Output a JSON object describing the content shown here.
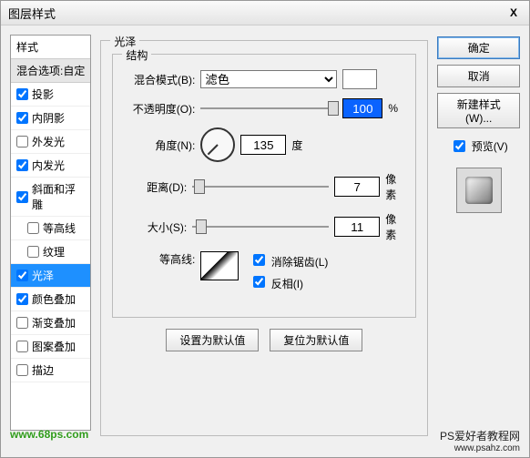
{
  "title": "图层样式",
  "close": "X",
  "sidebar": {
    "header": "样式",
    "sub": "混合选项:自定",
    "items": [
      {
        "label": "投影",
        "checked": true,
        "indent": false,
        "selected": false
      },
      {
        "label": "内阴影",
        "checked": true,
        "indent": false,
        "selected": false
      },
      {
        "label": "外发光",
        "checked": false,
        "indent": false,
        "selected": false
      },
      {
        "label": "内发光",
        "checked": true,
        "indent": false,
        "selected": false
      },
      {
        "label": "斜面和浮雕",
        "checked": true,
        "indent": false,
        "selected": false
      },
      {
        "label": "等高线",
        "checked": false,
        "indent": true,
        "selected": false
      },
      {
        "label": "纹理",
        "checked": false,
        "indent": true,
        "selected": false
      },
      {
        "label": "光泽",
        "checked": true,
        "indent": false,
        "selected": true
      },
      {
        "label": "颜色叠加",
        "checked": true,
        "indent": false,
        "selected": false
      },
      {
        "label": "渐变叠加",
        "checked": false,
        "indent": false,
        "selected": false
      },
      {
        "label": "图案叠加",
        "checked": false,
        "indent": false,
        "selected": false
      },
      {
        "label": "描边",
        "checked": false,
        "indent": false,
        "selected": false
      }
    ]
  },
  "panel": {
    "title": "光泽",
    "group": "结构",
    "blend_label": "混合模式(B):",
    "blend_value": "滤色",
    "opacity_label": "不透明度(O):",
    "opacity_value": "100",
    "percent": "%",
    "angle_label": "角度(N):",
    "angle_value": "135",
    "angle_unit": "度",
    "distance_label": "距离(D):",
    "distance_value": "7",
    "px": "像素",
    "size_label": "大小(S):",
    "size_value": "11",
    "contour_label": "等高线:",
    "anti_alias": "消除锯齿(L)",
    "invert": "反相(I)",
    "btn_default": "设置为默认值",
    "btn_reset": "复位为默认值"
  },
  "right": {
    "ok": "确定",
    "cancel": "取消",
    "newstyle": "新建样式(W)...",
    "preview": "预览(V)"
  },
  "watermark": {
    "left": "www.68ps.com",
    "right1": "PS爱好者教程网",
    "right2": "www.psahz.com"
  }
}
